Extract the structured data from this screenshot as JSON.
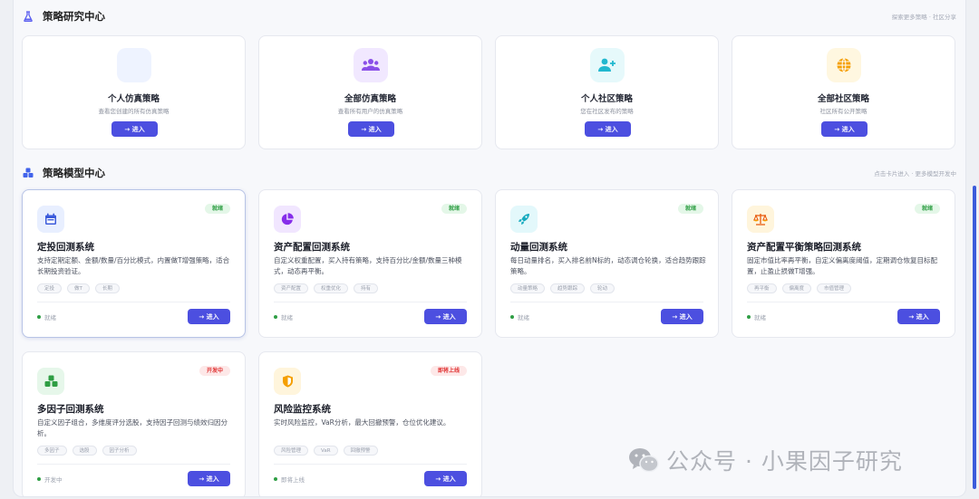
{
  "research_section": {
    "title": "策略研究中心",
    "hint": "探索更多策略 · 社区分享",
    "cards": [
      {
        "title": "个人仿真策略",
        "desc": "查看您创建的所有仿真策略",
        "button": "→ 进入",
        "icon": "blank-icon",
        "icon_bg": "#eef3ff"
      },
      {
        "title": "全部仿真策略",
        "desc": "查看所有用户的仿真策略",
        "button": "→ 进入",
        "icon": "users-icon",
        "icon_bg": "#f1e8ff"
      },
      {
        "title": "个人社区策略",
        "desc": "您在社区发布的策略",
        "button": "→ 进入",
        "icon": "user-plus-icon",
        "icon_bg": "#e6f9fb"
      },
      {
        "title": "全部社区策略",
        "desc": "社区所有公开策略",
        "button": "→ 进入",
        "icon": "globe-icon",
        "icon_bg": "#fff7e0"
      }
    ]
  },
  "model_section": {
    "title": "策略模型中心",
    "hint": "点击卡片进入 · 更多模型开发中",
    "cards": [
      {
        "title": "定投回测系统",
        "desc": "支持定期定额、金额/数量/百分比模式，内置做T增强策略，适合长期投资验证。",
        "badge": "就绪",
        "tags": [
          "定投",
          "做T",
          "长期"
        ],
        "status": "就绪",
        "button": "→ 进入",
        "icon": "calendar-icon"
      },
      {
        "title": "资产配置回测系统",
        "desc": "自定义权重配置，买入持有策略，支持百分比/金额/数量三种模式，动态再平衡。",
        "badge": "就绪",
        "tags": [
          "资产配置",
          "权重优化",
          "持有"
        ],
        "status": "就绪",
        "button": "→ 进入",
        "icon": "pie-chart-icon"
      },
      {
        "title": "动量回测系统",
        "desc": "每日动量排名，买入排名前N标的，动态调仓轮换，适合趋势跟踪策略。",
        "badge": "就绪",
        "tags": [
          "动量策略",
          "趋势跟踪",
          "轮动"
        ],
        "status": "就绪",
        "button": "→ 进入",
        "icon": "rocket-icon"
      },
      {
        "title": "资产配置平衡策略回测系统",
        "desc": "固定市值比率再平衡，自定义偏离度阈值，定期调仓恢复目标配置，止盈止损做T增强。",
        "badge": "就绪",
        "tags": [
          "再平衡",
          "偏离度",
          "市值管理"
        ],
        "status": "就绪",
        "button": "→ 进入",
        "icon": "balance-icon"
      },
      {
        "title": "多因子回测系统",
        "desc": "自定义因子组合，多维度评分选股，支持因子回测与绩效归因分析。",
        "badge": "开发中",
        "tags": [
          "多因子",
          "选股",
          "因子分析"
        ],
        "status": "开发中",
        "button": "→ 进入",
        "icon": "cubes-icon"
      },
      {
        "title": "风险监控系统",
        "desc": "实时风险监控，VaR分析，最大回撤预警，仓位优化建议。",
        "badge": "即将上线",
        "tags": [
          "风险管理",
          "VaR",
          "回撤预警"
        ],
        "status": "即将上线",
        "button": "→ 进入",
        "icon": "shield-icon"
      }
    ]
  },
  "watermark": {
    "text": "公众号 · 小果因子研究"
  },
  "colors": {
    "accent": "#4c4fe0",
    "ready": "#2f9e44",
    "dev": "#e03131"
  }
}
